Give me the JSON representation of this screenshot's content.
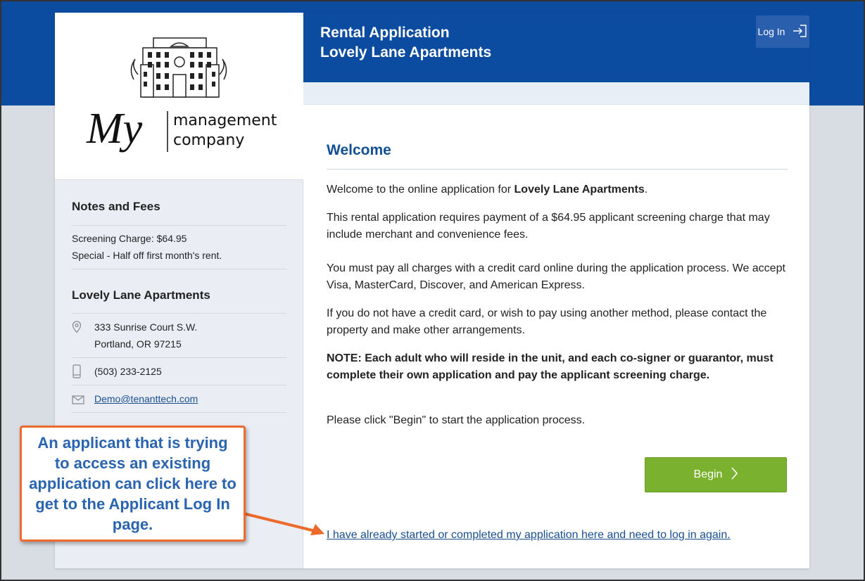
{
  "header": {
    "title_line1": "Rental Application",
    "title_line2": "Lovely Lane Apartments",
    "login_label": "Log In"
  },
  "logo": {
    "brand_letters": "My",
    "brand_line1": "management",
    "brand_line2": "company"
  },
  "sidebar": {
    "notes_title": "Notes and Fees",
    "notes": [
      "Screening Charge: $64.95",
      "Special - Half off first month's rent."
    ],
    "property_title": "Lovely Lane Apartments",
    "address_line1": "333 Sunrise Court S.W.",
    "address_line2": "Portland, OR 97215",
    "phone": "(503) 233-2125",
    "email": "Demo@tenanttech.com"
  },
  "main": {
    "heading": "Welcome",
    "intro_prefix": "Welcome to the online application for ",
    "intro_property": "Lovely Lane Apartments",
    "intro_suffix": ".",
    "p_fee": "This rental application requires payment of a $64.95 applicant screening charge that may include merchant and convenience fees.",
    "p_card": "You must pay all charges with a credit card online during the application process. We accept Visa, MasterCard, Discover, and American Express.",
    "p_other": "If you do not have a credit card, or wish to pay using another method, please contact the property and make other arrangements.",
    "p_note": "NOTE: Each adult who will reside in the unit, and each co-signer or guarantor, must complete their own application and pay the applicant screening charge.",
    "p_click": "Please click \"Begin\" to start the application process.",
    "begin_label": "Begin",
    "already_link": "I have already started or completed my application here and need to log in again."
  },
  "callout": {
    "text": "An applicant that is trying to access an existing application can click here to get to the Applicant Log In page."
  },
  "colors": {
    "header_blue": "#0c4ca0",
    "link_blue": "#1a4e8f",
    "button_green": "#7ab12e",
    "callout_orange": "#ec6a2c",
    "callout_text": "#2a64b0"
  }
}
